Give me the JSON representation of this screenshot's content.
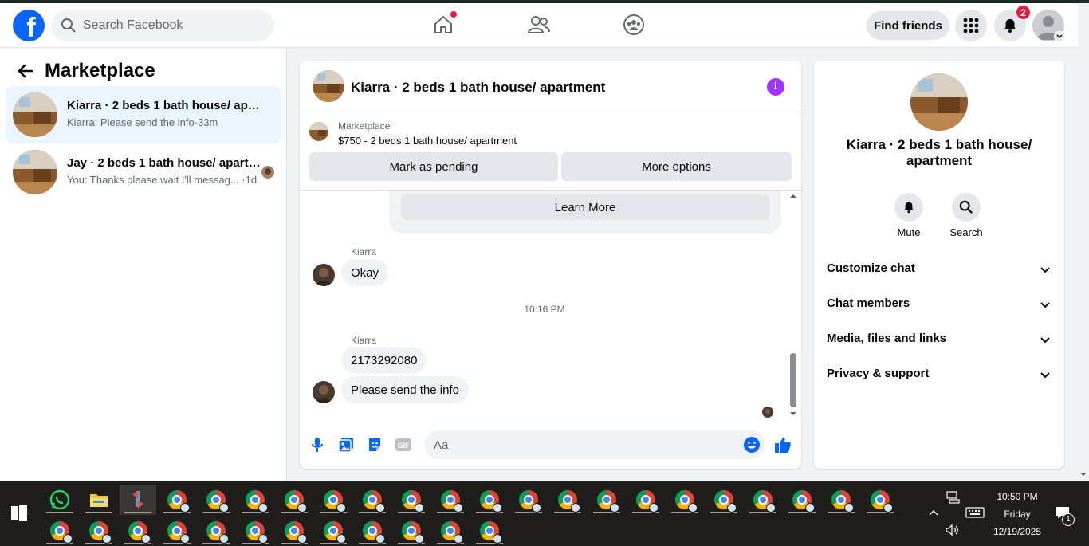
{
  "header": {
    "logo_letter": "f",
    "search_placeholder": "Search Facebook",
    "find_friends_label": "Find friends",
    "notifications_count": "2"
  },
  "sidebar": {
    "title": "Marketplace",
    "conversations": [
      {
        "name": "Kiarra · 2 beds 1 bath house/ apartment",
        "snippet": "Kiarra: Please send the info",
        "time": "·33m",
        "active": true
      },
      {
        "name": "Jay · 2 beds 1 bath house/ apartment",
        "snippet": "You: Thanks please wait I'll messag...",
        "time": "·1d",
        "active": false
      }
    ]
  },
  "chat": {
    "title": "Kiarra · 2 beds 1 bath house/ apartment",
    "listing_category": "Marketplace",
    "listing_price_title": "$750 - 2 beds 1 bath house/ apartment",
    "mark_pending_label": "Mark as pending",
    "more_options_label": "More options",
    "learn_more_label": "Learn More",
    "messages": [
      {
        "sender": "Kiarra",
        "text": "Okay"
      },
      {
        "timestamp": "10:16 PM"
      },
      {
        "sender": "Kiarra",
        "text": "2173292080"
      },
      {
        "text": "Please send the info"
      }
    ],
    "composer_placeholder": "Aa",
    "gif_label": "GIF"
  },
  "info_panel": {
    "name": "Kiarra · 2 beds 1 bath house/ apartment",
    "actions": [
      {
        "label": "Mute"
      },
      {
        "label": "Search"
      }
    ],
    "sections": [
      {
        "label": "Customize chat"
      },
      {
        "label": "Chat members"
      },
      {
        "label": "Media, files and links"
      },
      {
        "label": "Privacy & support"
      }
    ]
  },
  "taskbar": {
    "time": "10:50 PM",
    "day": "Friday",
    "date": "12/19/2025",
    "notification_count": "1"
  },
  "colors": {
    "brand": "#0866ff",
    "badge_red": "#e41e3f",
    "info_purple": "#a033ff",
    "taskbar": "#201e1c"
  }
}
